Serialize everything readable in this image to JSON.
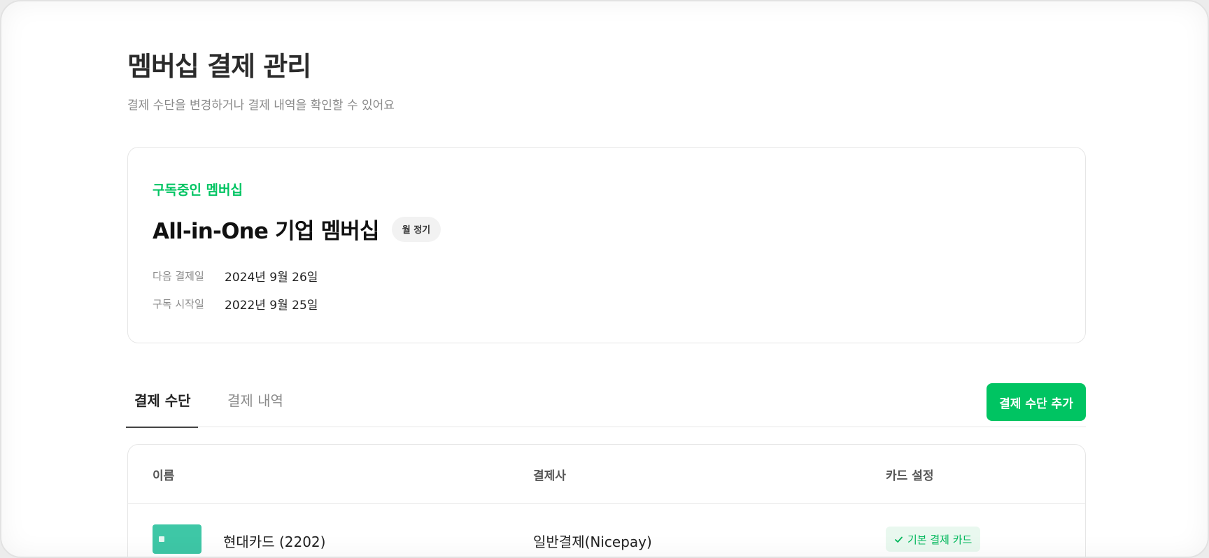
{
  "page": {
    "title": "멤버십 결제 관리",
    "subtitle": "결제 수단을 변경하거나 결제 내역을 확인할 수 있어요"
  },
  "subscription": {
    "section_label": "구독중인 멤버십",
    "plan_name": "All-in-One 기업 멤버십",
    "billing_badge": "월 정기",
    "next_payment_label": "다음 결제일",
    "next_payment_value": "2024년 9월 26일",
    "start_label": "구독 시작일",
    "start_value": "2022년 9월 25일"
  },
  "tabs": [
    {
      "label": "결제 수단",
      "active": true
    },
    {
      "label": "결제 내역",
      "active": false
    }
  ],
  "add_button_label": "결제 수단 추가",
  "table": {
    "columns": [
      "이름",
      "결제사",
      "카드 설정"
    ],
    "rows": [
      {
        "name": "현대카드 (2202)",
        "provider": "일반결제(Nicepay)",
        "setting": "기본 결제 카드",
        "icon": "credit-card-icon"
      }
    ]
  },
  "colors": {
    "accent": "#00c462",
    "card_icon": "#3ec7a6",
    "badge_bg": "#e9f8ef"
  }
}
